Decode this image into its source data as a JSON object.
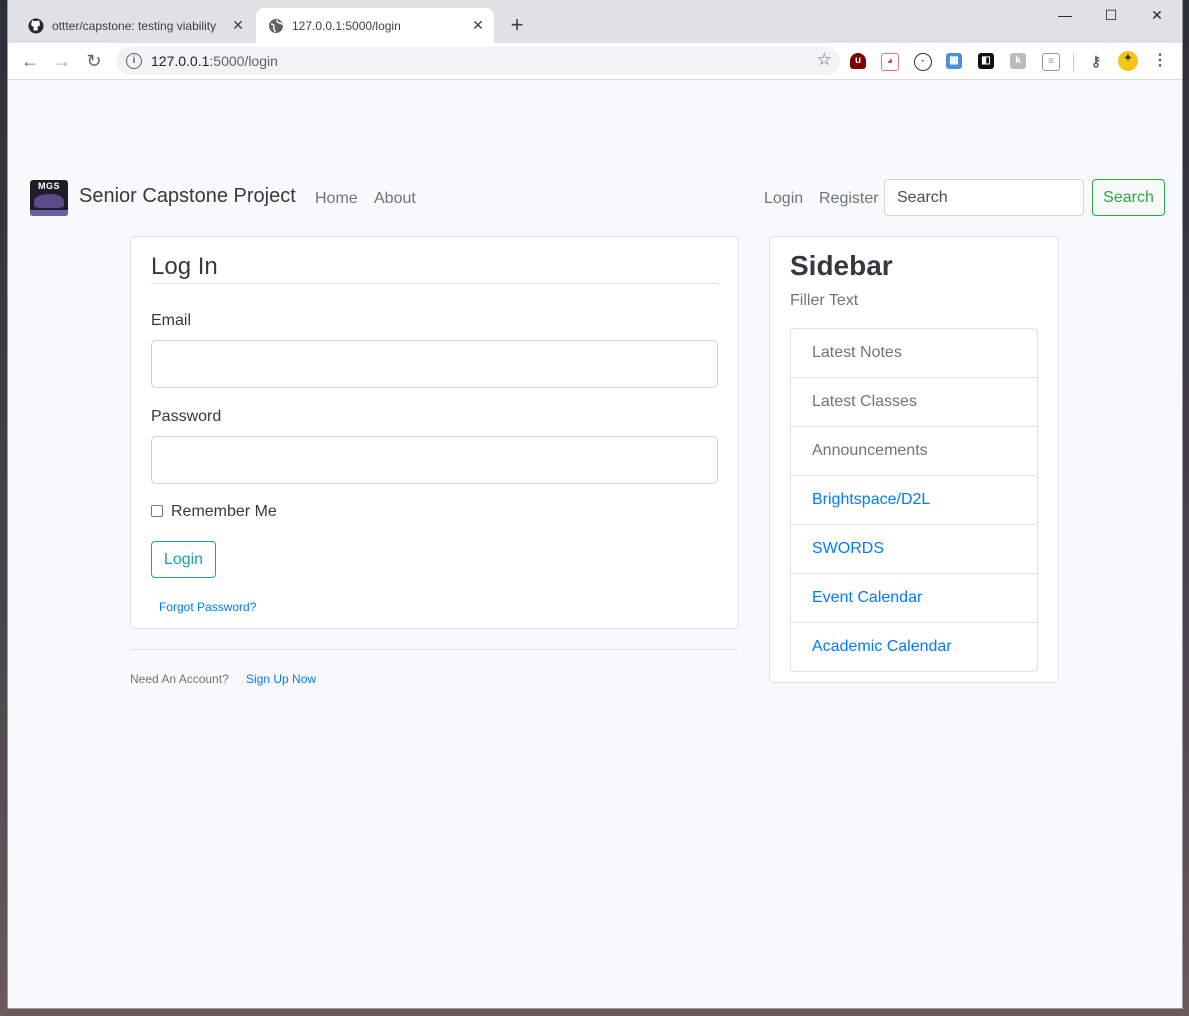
{
  "browser": {
    "tabs": [
      {
        "title": "ottter/capstone: testing viability",
        "active": false
      },
      {
        "title": "127.0.0.1:5000/login",
        "active": true
      }
    ],
    "url_host": "127.0.0.1",
    "url_rest": ":5000/login",
    "window_controls": {
      "minimize": "—",
      "maximize": "☐",
      "close": "✕"
    },
    "new_tab": "+"
  },
  "navbar": {
    "brand_logo_text": "MGS",
    "brand": "Senior Capstone Project",
    "links": [
      "Home",
      "About"
    ],
    "right_links": [
      "Login",
      "Register"
    ],
    "search_placeholder": "Search",
    "search_button": "Search"
  },
  "login": {
    "title": "Log In",
    "email_label": "Email",
    "email_value": "",
    "password_label": "Password",
    "password_value": "",
    "remember_label": "Remember Me",
    "remember_checked": false,
    "submit": "Login",
    "forgot": "Forgot Password?"
  },
  "footer": {
    "need_account": "Need An Account?",
    "signup": "Sign Up Now"
  },
  "sidebar": {
    "title": "Sidebar",
    "subtitle": "Filler Text",
    "items": [
      {
        "label": "Latest Notes",
        "link": false
      },
      {
        "label": "Latest Classes",
        "link": false
      },
      {
        "label": "Announcements",
        "link": false
      },
      {
        "label": "Brightspace/D2L",
        "link": true
      },
      {
        "label": "SWORDS",
        "link": true
      },
      {
        "label": "Event Calendar",
        "link": true
      },
      {
        "label": "Academic Calendar",
        "link": true
      }
    ]
  },
  "colors": {
    "primary_link": "#007bff",
    "info_outline": "#17a2b8",
    "success_outline": "#28a745",
    "page_bg": "#f8f9fa"
  }
}
